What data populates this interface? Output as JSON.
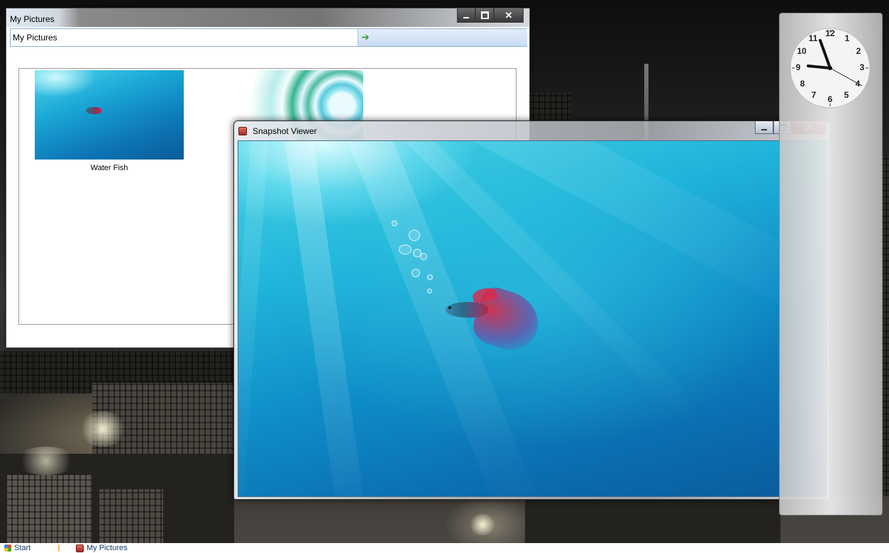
{
  "pictures_window": {
    "title": "My Pictures",
    "address": "My Pictures",
    "items": [
      {
        "caption": "Water Fish"
      }
    ]
  },
  "snapshot_window": {
    "title": "Snapshot Viewer"
  },
  "clock": {
    "numbers": [
      "12",
      "1",
      "2",
      "3",
      "4",
      "5",
      "6",
      "7",
      "8",
      "9",
      "10",
      "11"
    ]
  },
  "taskbar": {
    "start_label": "Start",
    "task_label": "My Pictures"
  },
  "icons": {
    "go": "arrow-right-icon",
    "close": "close-icon",
    "minimize": "minimize-icon",
    "maximize": "maximize-icon"
  }
}
